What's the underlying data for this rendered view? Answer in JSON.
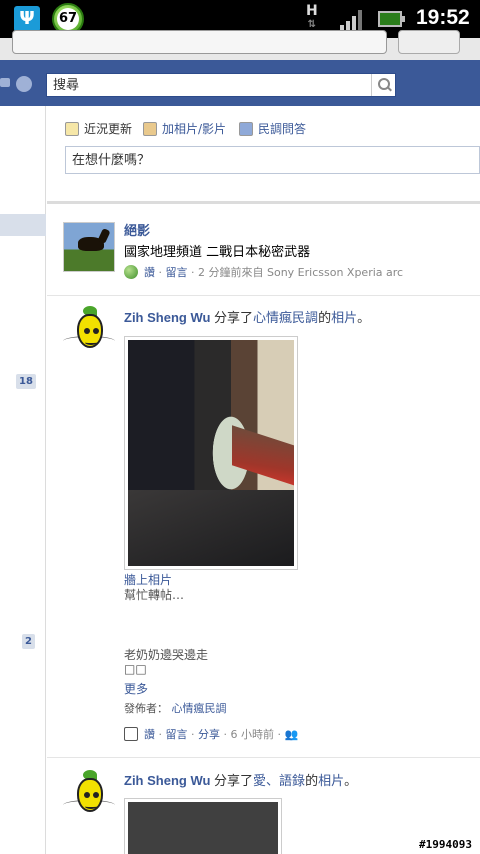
{
  "status_bar": {
    "time": "19:52",
    "notification_count": "67",
    "network_type": "H"
  },
  "search": {
    "placeholder": "搜尋"
  },
  "composer": {
    "tabs": [
      "近況更新",
      "加相片/影片",
      "民調問答"
    ],
    "placeholder": "在想什麼嗎？"
  },
  "left_nav": {
    "counts": [
      "18",
      "2"
    ]
  },
  "feed": [
    {
      "actor": "絕影",
      "text": "國家地理頻道 二戰日本秘密武器",
      "actions": [
        "讚",
        "留言"
      ],
      "meta_suffix": "2 分鐘前來自 Sony Ericsson Xperia arc"
    },
    {
      "actor": "Zih Sheng Wu",
      "verb": " 分享了",
      "target": "心情瘋民調",
      "target_suffix": "的",
      "object": "相片",
      "period": "。",
      "album": "牆上相片",
      "caption1": "幫忙轉帖…",
      "caption2": "老奶奶邊哭邊走",
      "caption3": "□□",
      "more": "更多",
      "poster_label": "發佈者：",
      "poster_name": "心情瘋民調",
      "actions": [
        "讚",
        "留言",
        "分享"
      ],
      "time": "6 小時前"
    },
    {
      "actor": "Zih Sheng Wu",
      "verb": " 分享了",
      "target": "愛、語錄",
      "target_suffix": "的",
      "object": "相片",
      "period": "。"
    }
  ],
  "watermark": "#1994093"
}
